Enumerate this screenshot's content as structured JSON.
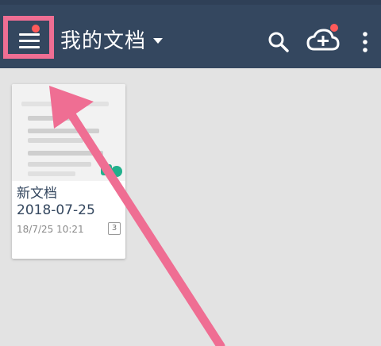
{
  "header": {
    "title": "我的文档"
  },
  "document": {
    "name": "新文档",
    "date": "2018-07-25",
    "modified": "18/7/25 10:21",
    "pages": "3"
  },
  "icons": {
    "menu": "hamburger-menu-icon",
    "search": "search-icon",
    "cloud": "cloud-upload-icon",
    "more": "more-vertical-icon"
  },
  "colors": {
    "appbar": "#34475f",
    "badge": "#ff5a5a",
    "annotation": "#ef6e93",
    "accent": "#22b08c"
  }
}
